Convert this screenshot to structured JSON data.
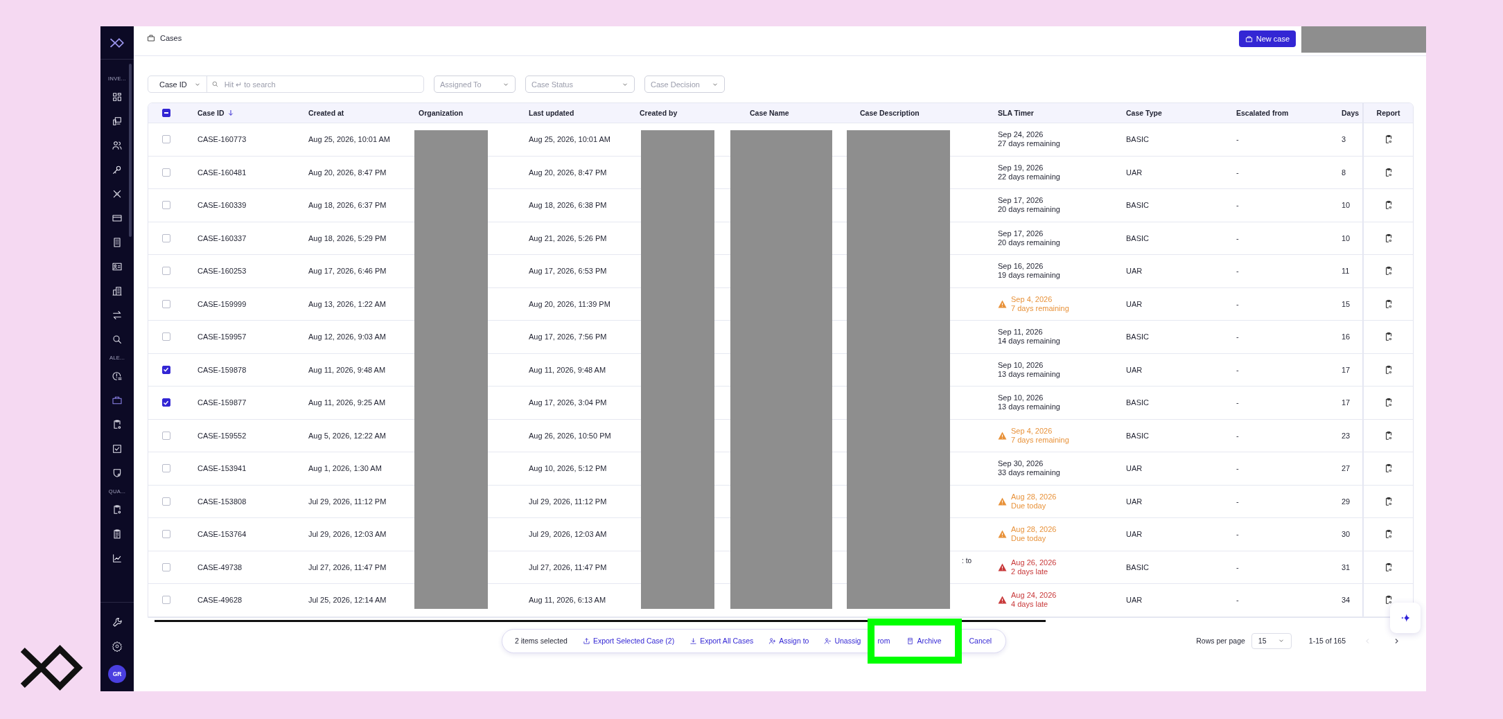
{
  "sidebar": {
    "sections": [
      {
        "label": "INVE...",
        "items": [
          {
            "selected": false
          },
          {
            "selected": false
          },
          {
            "selected": false
          },
          {
            "selected": false
          },
          {
            "selected": false
          },
          {
            "selected": false
          },
          {
            "selected": false
          },
          {
            "selected": false
          },
          {
            "selected": false
          },
          {
            "selected": false
          },
          {
            "selected": false
          }
        ]
      },
      {
        "label": "ALE...",
        "items": [
          {
            "selected": false
          },
          {
            "selected": true
          },
          {
            "selected": false
          },
          {
            "selected": false
          },
          {
            "selected": false
          }
        ]
      },
      {
        "label": "QUA...",
        "items": [
          {
            "selected": false
          },
          {
            "selected": false
          },
          {
            "selected": false
          }
        ]
      }
    ],
    "avatar": "GR"
  },
  "header": {
    "title": "Cases",
    "new_case_button": "New case"
  },
  "filters": {
    "search_by": "Case ID",
    "search_placeholder": "Hit ↵ to search",
    "dropdowns": [
      {
        "placeholder": "Assigned To"
      },
      {
        "placeholder": "Case Status"
      },
      {
        "placeholder": "Case Decision"
      }
    ]
  },
  "table": {
    "header_checkbox": {
      "indeterminate": true
    },
    "columns": [
      {
        "label": "Case ID",
        "sorted_descending": true
      },
      {
        "label": "Created at"
      },
      {
        "label": "Organization"
      },
      {
        "label": "Last updated"
      },
      {
        "label": "Created by"
      },
      {
        "label": "Case Name"
      },
      {
        "label": "Case Description"
      },
      {
        "label": "SLA Timer"
      },
      {
        "label": "Case Type"
      },
      {
        "label": "Escalated from"
      },
      {
        "label": "Days"
      },
      {
        "label": "Report"
      }
    ],
    "rows": [
      {
        "selected": false,
        "case_id": "CASE-160773",
        "created_at": "Aug 25, 2026, 10:01 AM",
        "last_updated": "Aug 25, 2026, 10:01 AM",
        "sla_date": "Sep 24, 2026",
        "sla_note": "27 days remaining",
        "kind": "normal",
        "case_type": "BASIC",
        "escalated_from": "-",
        "days": "3"
      },
      {
        "selected": false,
        "case_id": "CASE-160481",
        "created_at": "Aug 20, 2026, 8:47 PM",
        "last_updated": "Aug 20, 2026, 8:47 PM",
        "sla_date": "Sep 19, 2026",
        "sla_note": "22 days remaining",
        "kind": "normal",
        "case_type": "UAR",
        "escalated_from": "-",
        "days": "8"
      },
      {
        "selected": false,
        "case_id": "CASE-160339",
        "created_at": "Aug 18, 2026, 6:37 PM",
        "last_updated": "Aug 18, 2026, 6:38 PM",
        "sla_date": "Sep 17, 2026",
        "sla_note": "20 days remaining",
        "kind": "normal",
        "case_type": "BASIC",
        "escalated_from": "-",
        "days": "10"
      },
      {
        "selected": false,
        "case_id": "CASE-160337",
        "created_at": "Aug 18, 2026, 5:29 PM",
        "last_updated": "Aug 21, 2026, 5:26 PM",
        "sla_date": "Sep 17, 2026",
        "sla_note": "20 days remaining",
        "kind": "normal",
        "case_type": "BASIC",
        "escalated_from": "-",
        "days": "10"
      },
      {
        "selected": false,
        "case_id": "CASE-160253",
        "created_at": "Aug 17, 2026, 6:46 PM",
        "last_updated": "Aug 17, 2026, 6:53 PM",
        "sla_date": "Sep 16, 2026",
        "sla_note": "19 days remaining",
        "kind": "normal",
        "case_type": "UAR",
        "escalated_from": "-",
        "days": "11"
      },
      {
        "selected": false,
        "case_id": "CASE-159999",
        "created_at": "Aug 13, 2026, 1:22 AM",
        "last_updated": "Aug 20, 2026, 11:39 PM",
        "sla_date": "Sep 4, 2026",
        "sla_note": "7 days remaining",
        "kind": "warning",
        "case_type": "UAR",
        "escalated_from": "-",
        "days": "15"
      },
      {
        "selected": false,
        "case_id": "CASE-159957",
        "created_at": "Aug 12, 2026, 9:03 AM",
        "last_updated": "Aug 17, 2026, 7:56 PM",
        "sla_date": "Sep 11, 2026",
        "sla_note": "14 days remaining",
        "kind": "normal",
        "case_type": "BASIC",
        "escalated_from": "-",
        "days": "16"
      },
      {
        "selected": true,
        "case_id": "CASE-159878",
        "created_at": "Aug 11, 2026, 9:48 AM",
        "last_updated": "Aug 11, 2026, 9:48 AM",
        "sla_date": "Sep 10, 2026",
        "sla_note": "13 days remaining",
        "kind": "normal",
        "case_type": "UAR",
        "escalated_from": "-",
        "days": "17"
      },
      {
        "selected": true,
        "case_id": "CASE-159877",
        "created_at": "Aug 11, 2026, 9:25 AM",
        "last_updated": "Aug 17, 2026, 3:04 PM",
        "sla_date": "Sep 10, 2026",
        "sla_note": "13 days remaining",
        "kind": "normal",
        "case_type": "BASIC",
        "escalated_from": "-",
        "days": "17"
      },
      {
        "selected": false,
        "case_id": "CASE-159552",
        "created_at": "Aug 5, 2026, 12:22 AM",
        "last_updated": "Aug 26, 2026, 10:50 PM",
        "sla_date": "Sep 4, 2026",
        "sla_note": "7 days remaining",
        "kind": "warning",
        "case_type": "BASIC",
        "escalated_from": "-",
        "days": "23"
      },
      {
        "selected": false,
        "case_id": "CASE-153941",
        "created_at": "Aug 1, 2026, 1:30 AM",
        "last_updated": "Aug 10, 2026, 5:12 PM",
        "sla_date": "Sep 30, 2026",
        "sla_note": "33 days remaining",
        "kind": "normal",
        "case_type": "UAR",
        "escalated_from": "-",
        "days": "27"
      },
      {
        "selected": false,
        "case_id": "CASE-153808",
        "created_at": "Jul 29, 2026, 11:12 PM",
        "last_updated": "Jul 29, 2026, 11:12 PM",
        "sla_date": "Aug 28, 2026",
        "sla_note": "Due today",
        "kind": "warning",
        "case_type": "UAR",
        "escalated_from": "-",
        "days": "29"
      },
      {
        "selected": false,
        "case_id": "CASE-153764",
        "created_at": "Jul 29, 2026, 12:03 AM",
        "last_updated": "Jul 29, 2026, 12:03 AM",
        "sla_date": "Aug 28, 2026",
        "sla_note": "Due today",
        "kind": "warning",
        "case_type": "UAR",
        "escalated_from": "-",
        "days": "30"
      },
      {
        "selected": false,
        "case_id": "CASE-49738",
        "created_at": "Jul 27, 2026, 11:47 PM",
        "last_updated": "Jul 27, 2026, 11:47 PM",
        "case_description": ": to",
        "sla_date": "Aug 26, 2026",
        "sla_note": "2 days late",
        "kind": "late",
        "case_type": "BASIC",
        "escalated_from": "-",
        "days": "31"
      },
      {
        "selected": false,
        "case_id": "CASE-49628",
        "created_at": "Jul 25, 2026, 12:14 AM",
        "last_updated": "Aug 11, 2026, 6:13 AM",
        "sla_date": "Aug 24, 2026",
        "sla_note": "4 days late",
        "kind": "late",
        "case_type": "UAR",
        "escalated_from": "-",
        "days": "34"
      }
    ]
  },
  "bulk_actions": {
    "count": "2 items selected",
    "actions": [
      {
        "label": "Export Selected Case (2)",
        "kind": "export"
      },
      {
        "label": "Export All Cases",
        "kind": "download"
      },
      {
        "label": "Assign to",
        "kind": "assign"
      },
      {
        "label": "Unassig",
        "kind": "unassign"
      }
    ],
    "highlight": {
      "fragment": "rom",
      "action": "Archive"
    },
    "cancel": "Cancel"
  },
  "pagination": {
    "rows_per_page_label": "Rows per page",
    "rows_per_page": "15",
    "range": "1-15 of 165",
    "prev_disabled": true,
    "next_disabled": false
  }
}
